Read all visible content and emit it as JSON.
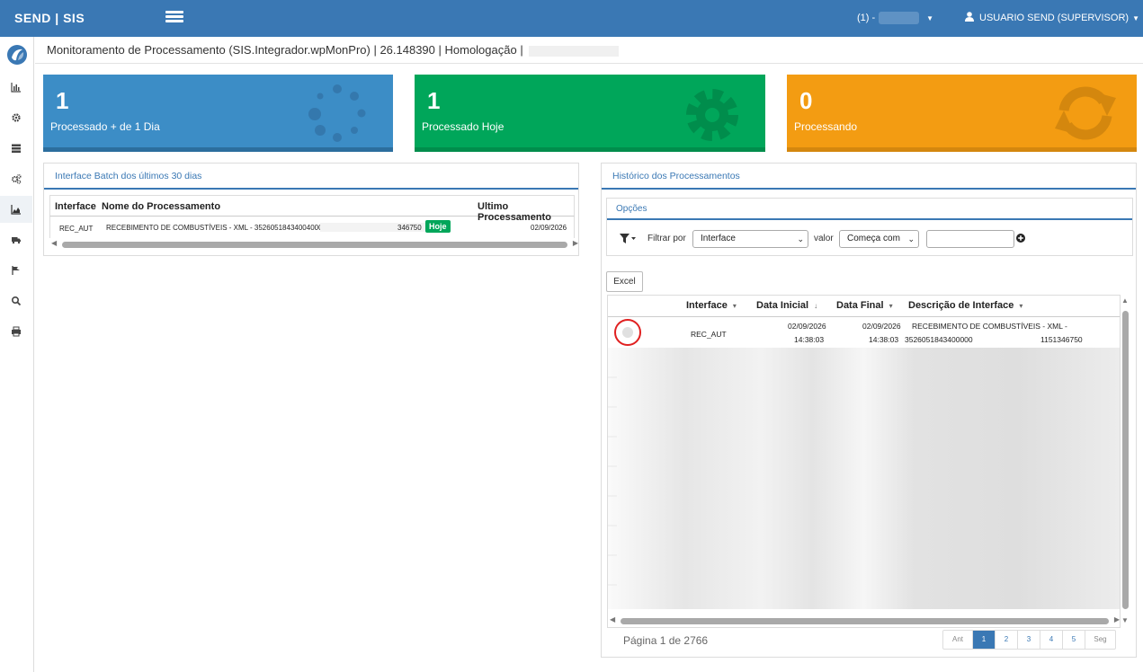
{
  "header": {
    "brand": "SEND | SIS",
    "company_label": "(1) -",
    "user_label": "USUARIO SEND (SUPERVISOR)"
  },
  "sidebar": {
    "items": [
      {
        "icon": "bar-chart-icon"
      },
      {
        "icon": "gear-icon"
      },
      {
        "icon": "server-icon"
      },
      {
        "icon": "cogs-icon"
      },
      {
        "icon": "area-chart-icon"
      },
      {
        "icon": "truck-icon"
      },
      {
        "icon": "flag-icon"
      },
      {
        "icon": "search-icon"
      },
      {
        "icon": "print-icon"
      }
    ]
  },
  "breadcrumb": {
    "text": "Monitoramento de Processamento (SIS.Integrador.wpMonPro) | 26.148390 | Homologação |"
  },
  "tiles": [
    {
      "count": "1",
      "label": "Processado + de 1 Dia",
      "color": "#3c8dc6"
    },
    {
      "count": "1",
      "label": "Processado Hoje",
      "color": "#00a65a"
    },
    {
      "count": "0",
      "label": "Processando",
      "color": "#f39c12"
    }
  ],
  "batch_panel": {
    "title": "Interface Batch dos últimos 30 dias",
    "columns": [
      "Interface",
      "Nome do Processamento",
      "Ultimo Processamento"
    ],
    "rows": [
      {
        "interface": "REC_AUT",
        "name": "RECEBIMENTO DE COMBUSTÍVEIS - XML - 35260518434004000",
        "name_tail": "346750",
        "badge": "Hoje",
        "date": "02/09/2026"
      }
    ]
  },
  "history_panel": {
    "title": "Histórico dos Processamentos",
    "options_title": "Opções",
    "filter_label": "Filtrar por",
    "filter_value": "Interface",
    "valor_label": "valor",
    "match_value": "Começa com",
    "search_value": "",
    "excel_label": "Excel",
    "columns": [
      {
        "label": "Interface",
        "sort": "▾"
      },
      {
        "label": "Data Inicial",
        "sort": "↓"
      },
      {
        "label": "Data Final",
        "sort": "▾"
      },
      {
        "label": "Descrição de Interface",
        "sort": "▾"
      }
    ],
    "rows": [
      {
        "interface": "REC_AUT",
        "start_date": "02/09/2026",
        "start_time": "14:38:03",
        "end_date": "02/09/2026",
        "end_time": "14:38:03",
        "desc_line1": "RECEBIMENTO DE COMBUSTÍVEIS - XML -",
        "desc_line2": "3526051843400000",
        "desc_tail": "1151346750"
      }
    ],
    "page_info": "Página 1 de 2766",
    "pager": {
      "prev": "Ant",
      "pages": [
        "1",
        "2",
        "3",
        "4",
        "5"
      ],
      "next": "Seg",
      "current": "1"
    }
  }
}
